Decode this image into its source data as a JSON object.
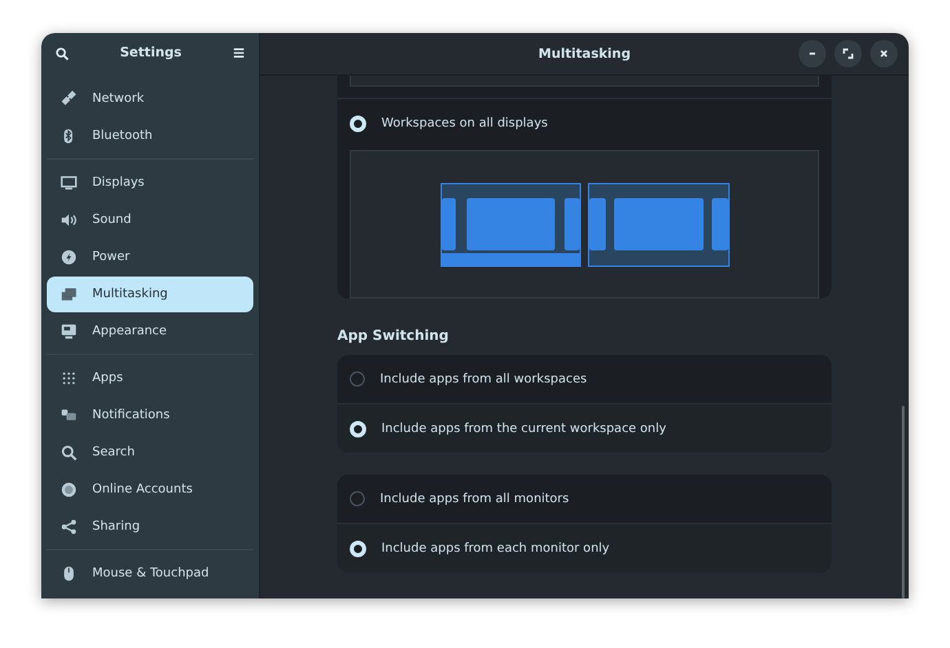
{
  "sidebar": {
    "title": "Settings",
    "groups": [
      [
        {
          "label": "Network",
          "selected": false
        },
        {
          "label": "Bluetooth",
          "selected": false
        }
      ],
      [
        {
          "label": "Displays",
          "selected": false
        },
        {
          "label": "Sound",
          "selected": false
        },
        {
          "label": "Power",
          "selected": false
        },
        {
          "label": "Multitasking",
          "selected": true
        },
        {
          "label": "Appearance",
          "selected": false
        }
      ],
      [
        {
          "label": "Apps",
          "selected": false
        },
        {
          "label": "Notifications",
          "selected": false
        },
        {
          "label": "Search",
          "selected": false
        },
        {
          "label": "Online Accounts",
          "selected": false
        },
        {
          "label": "Sharing",
          "selected": false
        }
      ],
      [
        {
          "label": "Mouse & Touchpad",
          "selected": false
        }
      ]
    ]
  },
  "window": {
    "title": "Multitasking"
  },
  "workspaces_card": {
    "option": {
      "label": "Workspaces on all displays",
      "selected": true
    }
  },
  "app_switching": {
    "heading": "App Switching",
    "groups": [
      [
        {
          "label": "Include apps from all workspaces",
          "selected": false
        },
        {
          "label": "Include apps from the current workspace only",
          "selected": true
        }
      ],
      [
        {
          "label": "Include apps from all monitors",
          "selected": false
        },
        {
          "label": "Include apps from each monitor only",
          "selected": true
        }
      ]
    ]
  }
}
